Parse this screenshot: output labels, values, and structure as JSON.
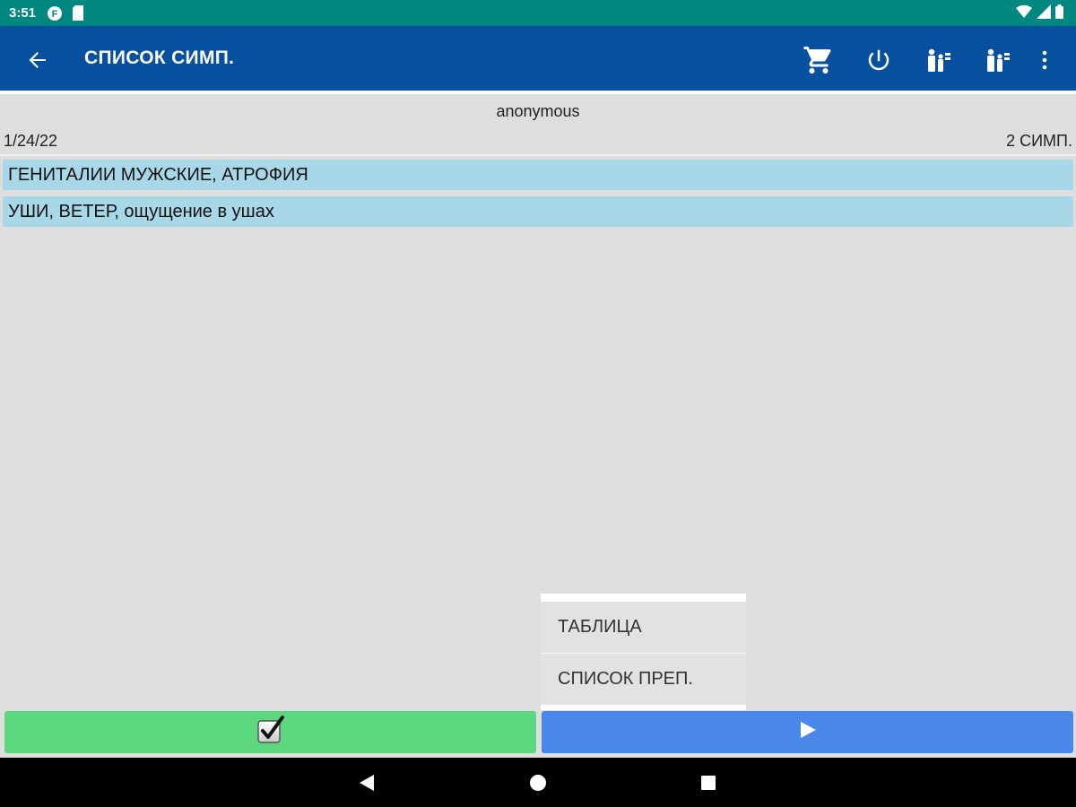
{
  "status_bar": {
    "time": "3:51",
    "icons": [
      "notification-f-icon",
      "sd-card-icon",
      "wifi-icon",
      "signal-icon",
      "battery-icon"
    ]
  },
  "app_bar": {
    "title": "СПИСОК СИМП.",
    "color": "#0750a0",
    "actions": [
      "cart-icon",
      "power-icon",
      "family-icon",
      "family-icon",
      "more-vert-icon"
    ]
  },
  "content": {
    "user": "anonymous",
    "date": "1/24/22",
    "count": "2 СИМП.",
    "symptoms": [
      "ГЕНИТАЛИИ МУЖСКИЕ, АТРОФИЯ",
      "УШИ, ВЕТЕР, ощущение в ушах"
    ]
  },
  "popup_menu": {
    "items": [
      "ТАБЛИЦА",
      "СПИСОК ПРЕП."
    ]
  },
  "bottom_buttons": {
    "confirm_icon": "checkbox-checked-icon",
    "next_icon": "play-icon",
    "confirm_color": "#5bd87e",
    "next_color": "#4a87ea"
  },
  "nav_bar": {
    "buttons": [
      "back-triangle-icon",
      "home-circle-icon",
      "recents-square-icon"
    ]
  }
}
